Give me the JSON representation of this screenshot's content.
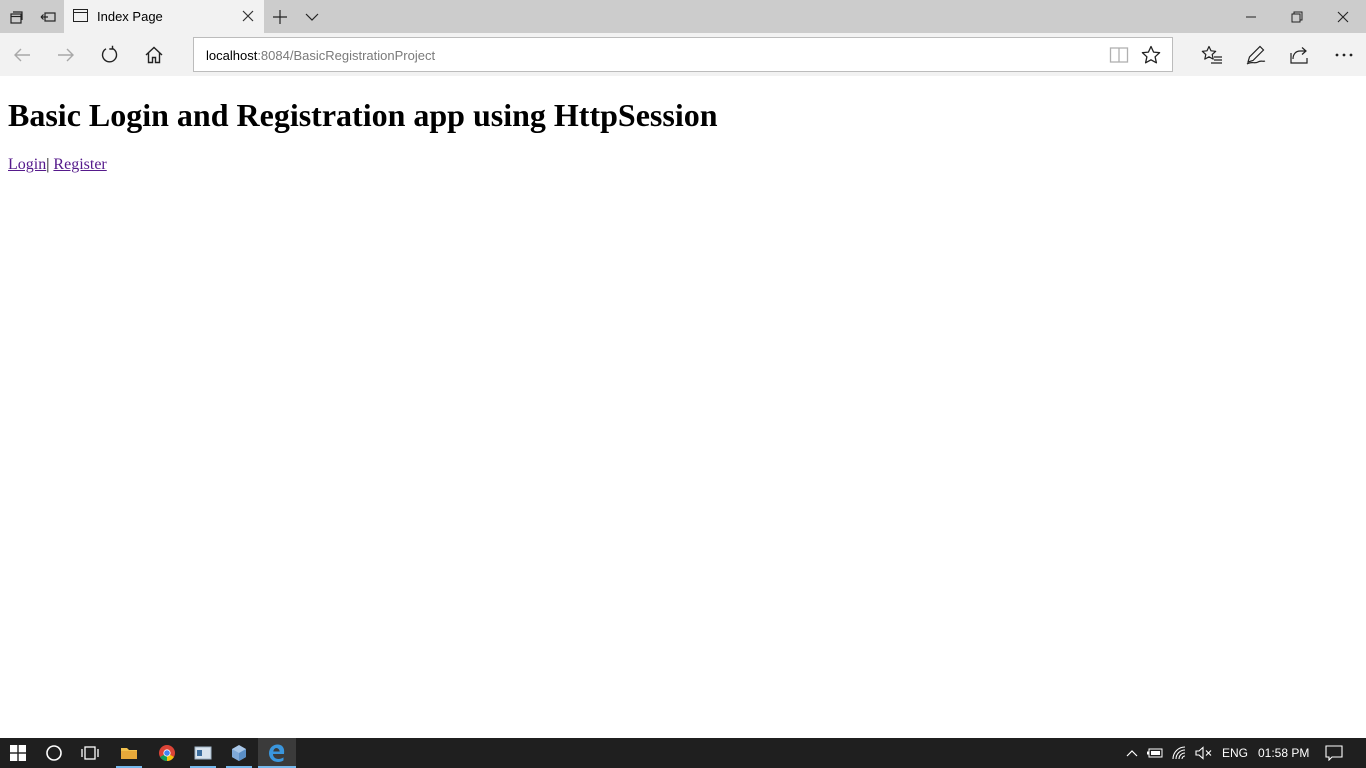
{
  "browser": {
    "tab": {
      "title": "Index Page"
    },
    "address": {
      "host": "localhost",
      "rest": ":8084/BasicRegistrationProject"
    }
  },
  "page": {
    "heading": "Basic Login and Registration app using HttpSession",
    "links": {
      "login": "Login",
      "separator": "|",
      "register": "Register"
    }
  },
  "taskbar": {
    "language": "ENG",
    "clock": "01:58 PM"
  },
  "colors": {
    "tabbar": "#cccccc",
    "navbar": "#f2f2f2",
    "visited_link": "#551a8b",
    "taskbar": "#1f1f1f",
    "taskbar_accent": "#76b9ed"
  }
}
